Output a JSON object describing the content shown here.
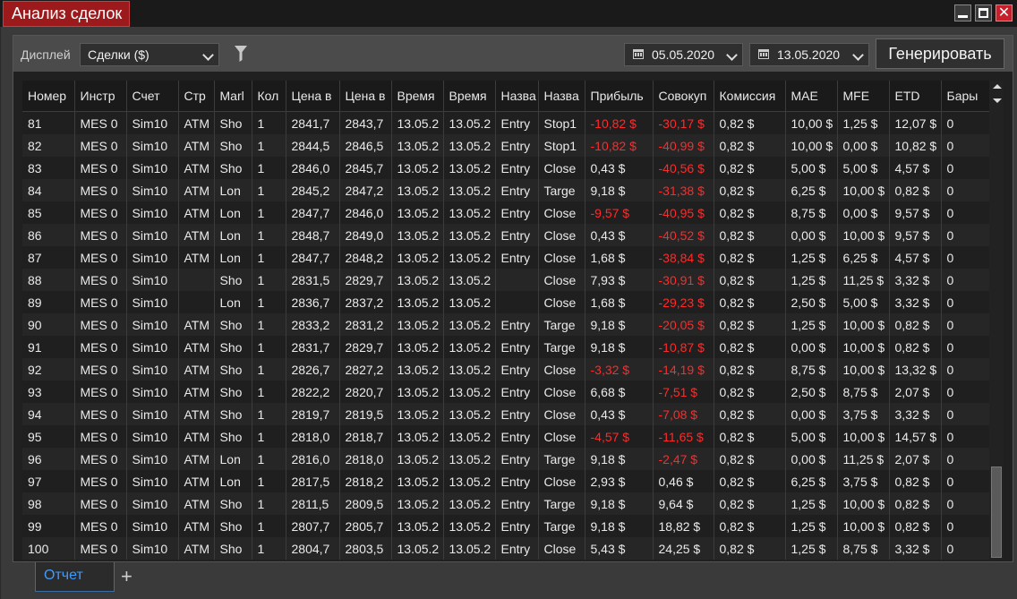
{
  "window": {
    "title": "Анализ сделок"
  },
  "toolbar": {
    "display_label": "Дисплей",
    "view_value": "Сделки ($)",
    "date_from": "05.05.2020",
    "date_to": "13.05.2020",
    "generate_label": "Генерировать"
  },
  "columns": [
    "Номер",
    "Инстр",
    "Счет",
    "Стр",
    "Marl",
    "Кол",
    "Цена в",
    "Цена в",
    "Время",
    "Время",
    "Назва",
    "Назва",
    "Прибыль",
    "Совокуп",
    "Комиссия",
    "MAE",
    "MFE",
    "ETD",
    "Бары"
  ],
  "column_widths": [
    58,
    58,
    58,
    40,
    42,
    38,
    60,
    58,
    58,
    58,
    48,
    52,
    76,
    68,
    80,
    58,
    58,
    58,
    58
  ],
  "rows": [
    [
      "81",
      "MES 0",
      "Sim10",
      "ATM",
      "Sho",
      "1",
      "2841,7",
      "2843,7",
      "13.05.2",
      "13.05.2",
      "Entry",
      "Stop1",
      "-10,82 $",
      "-30,17 $",
      "0,82 $",
      "10,00 $",
      "1,25 $",
      "12,07 $",
      "0"
    ],
    [
      "82",
      "MES 0",
      "Sim10",
      "ATM",
      "Sho",
      "1",
      "2844,5",
      "2846,5",
      "13.05.2",
      "13.05.2",
      "Entry",
      "Stop1",
      "-10,82 $",
      "-40,99 $",
      "0,82 $",
      "10,00 $",
      "0,00 $",
      "10,82 $",
      "0"
    ],
    [
      "83",
      "MES 0",
      "Sim10",
      "ATM",
      "Sho",
      "1",
      "2846,0",
      "2845,7",
      "13.05.2",
      "13.05.2",
      "Entry",
      "Close",
      "0,43 $",
      "-40,56 $",
      "0,82 $",
      "5,00 $",
      "5,00 $",
      "4,57 $",
      "0"
    ],
    [
      "84",
      "MES 0",
      "Sim10",
      "ATM",
      "Lon",
      "1",
      "2845,2",
      "2847,2",
      "13.05.2",
      "13.05.2",
      "Entry",
      "Targe",
      "9,18 $",
      "-31,38 $",
      "0,82 $",
      "6,25 $",
      "10,00 $",
      "0,82 $",
      "0"
    ],
    [
      "85",
      "MES 0",
      "Sim10",
      "ATM",
      "Lon",
      "1",
      "2847,7",
      "2846,0",
      "13.05.2",
      "13.05.2",
      "Entry",
      "Close",
      "-9,57 $",
      "-40,95 $",
      "0,82 $",
      "8,75 $",
      "0,00 $",
      "9,57 $",
      "0"
    ],
    [
      "86",
      "MES 0",
      "Sim10",
      "ATM",
      "Lon",
      "1",
      "2848,7",
      "2849,0",
      "13.05.2",
      "13.05.2",
      "Entry",
      "Close",
      "0,43 $",
      "-40,52 $",
      "0,82 $",
      "0,00 $",
      "10,00 $",
      "9,57 $",
      "0"
    ],
    [
      "87",
      "MES 0",
      "Sim10",
      "ATM",
      "Lon",
      "1",
      "2847,7",
      "2848,2",
      "13.05.2",
      "13.05.2",
      "Entry",
      "Close",
      "1,68 $",
      "-38,84 $",
      "0,82 $",
      "1,25 $",
      "6,25 $",
      "4,57 $",
      "0"
    ],
    [
      "88",
      "MES 0",
      "Sim10",
      "",
      "Sho",
      "1",
      "2831,5",
      "2829,7",
      "13.05.2",
      "13.05.2",
      "",
      "Close",
      "7,93 $",
      "-30,91 $",
      "0,82 $",
      "1,25 $",
      "11,25 $",
      "3,32 $",
      "0"
    ],
    [
      "89",
      "MES 0",
      "Sim10",
      "",
      "Lon",
      "1",
      "2836,7",
      "2837,2",
      "13.05.2",
      "13.05.2",
      "",
      "Close",
      "1,68 $",
      "-29,23 $",
      "0,82 $",
      "2,50 $",
      "5,00 $",
      "3,32 $",
      "0"
    ],
    [
      "90",
      "MES 0",
      "Sim10",
      "ATM",
      "Sho",
      "1",
      "2833,2",
      "2831,2",
      "13.05.2",
      "13.05.2",
      "Entry",
      "Targe",
      "9,18 $",
      "-20,05 $",
      "0,82 $",
      "1,25 $",
      "10,00 $",
      "0,82 $",
      "0"
    ],
    [
      "91",
      "MES 0",
      "Sim10",
      "ATM",
      "Sho",
      "1",
      "2831,7",
      "2829,7",
      "13.05.2",
      "13.05.2",
      "Entry",
      "Targe",
      "9,18 $",
      "-10,87 $",
      "0,82 $",
      "0,00 $",
      "10,00 $",
      "0,82 $",
      "0"
    ],
    [
      "92",
      "MES 0",
      "Sim10",
      "ATM",
      "Sho",
      "1",
      "2826,7",
      "2827,2",
      "13.05.2",
      "13.05.2",
      "Entry",
      "Close",
      "-3,32 $",
      "-14,19 $",
      "0,82 $",
      "8,75 $",
      "10,00 $",
      "13,32 $",
      "0"
    ],
    [
      "93",
      "MES 0",
      "Sim10",
      "ATM",
      "Sho",
      "1",
      "2822,2",
      "2820,7",
      "13.05.2",
      "13.05.2",
      "Entry",
      "Close",
      "6,68 $",
      "-7,51 $",
      "0,82 $",
      "2,50 $",
      "8,75 $",
      "2,07 $",
      "0"
    ],
    [
      "94",
      "MES 0",
      "Sim10",
      "ATM",
      "Sho",
      "1",
      "2819,7",
      "2819,5",
      "13.05.2",
      "13.05.2",
      "Entry",
      "Close",
      "0,43 $",
      "-7,08 $",
      "0,82 $",
      "0,00 $",
      "3,75 $",
      "3,32 $",
      "0"
    ],
    [
      "95",
      "MES 0",
      "Sim10",
      "ATM",
      "Sho",
      "1",
      "2818,0",
      "2818,7",
      "13.05.2",
      "13.05.2",
      "Entry",
      "Close",
      "-4,57 $",
      "-11,65 $",
      "0,82 $",
      "5,00 $",
      "10,00 $",
      "14,57 $",
      "0"
    ],
    [
      "96",
      "MES 0",
      "Sim10",
      "ATM",
      "Lon",
      "1",
      "2816,0",
      "2818,0",
      "13.05.2",
      "13.05.2",
      "Entry",
      "Targe",
      "9,18 $",
      "-2,47 $",
      "0,82 $",
      "0,00 $",
      "11,25 $",
      "2,07 $",
      "0"
    ],
    [
      "97",
      "MES 0",
      "Sim10",
      "ATM",
      "Lon",
      "1",
      "2817,5",
      "2818,2",
      "13.05.2",
      "13.05.2",
      "Entry",
      "Close",
      "2,93 $",
      "0,46 $",
      "0,82 $",
      "6,25 $",
      "3,75 $",
      "0,82 $",
      "0"
    ],
    [
      "98",
      "MES 0",
      "Sim10",
      "ATM",
      "Sho",
      "1",
      "2811,5",
      "2809,5",
      "13.05.2",
      "13.05.2",
      "Entry",
      "Targe",
      "9,18 $",
      "9,64 $",
      "0,82 $",
      "1,25 $",
      "10,00 $",
      "0,82 $",
      "0"
    ],
    [
      "99",
      "MES 0",
      "Sim10",
      "ATM",
      "Sho",
      "1",
      "2807,7",
      "2805,7",
      "13.05.2",
      "13.05.2",
      "Entry",
      "Targe",
      "9,18 $",
      "18,82 $",
      "0,82 $",
      "1,25 $",
      "10,00 $",
      "0,82 $",
      "0"
    ],
    [
      "100",
      "MES 0",
      "Sim10",
      "ATM",
      "Sho",
      "1",
      "2804,7",
      "2803,5",
      "13.05.2",
      "13.05.2",
      "Entry",
      "Close",
      "5,43 $",
      "24,25 $",
      "0,82 $",
      "1,25 $",
      "8,75 $",
      "3,32 $",
      "0"
    ]
  ],
  "tabs": [
    {
      "label": "Отчет"
    }
  ],
  "add_tab_label": "+",
  "colors": {
    "title_bg": "#9c1a1c",
    "negative": "#ff2a2a",
    "tab_accent": "#3e9bff"
  }
}
